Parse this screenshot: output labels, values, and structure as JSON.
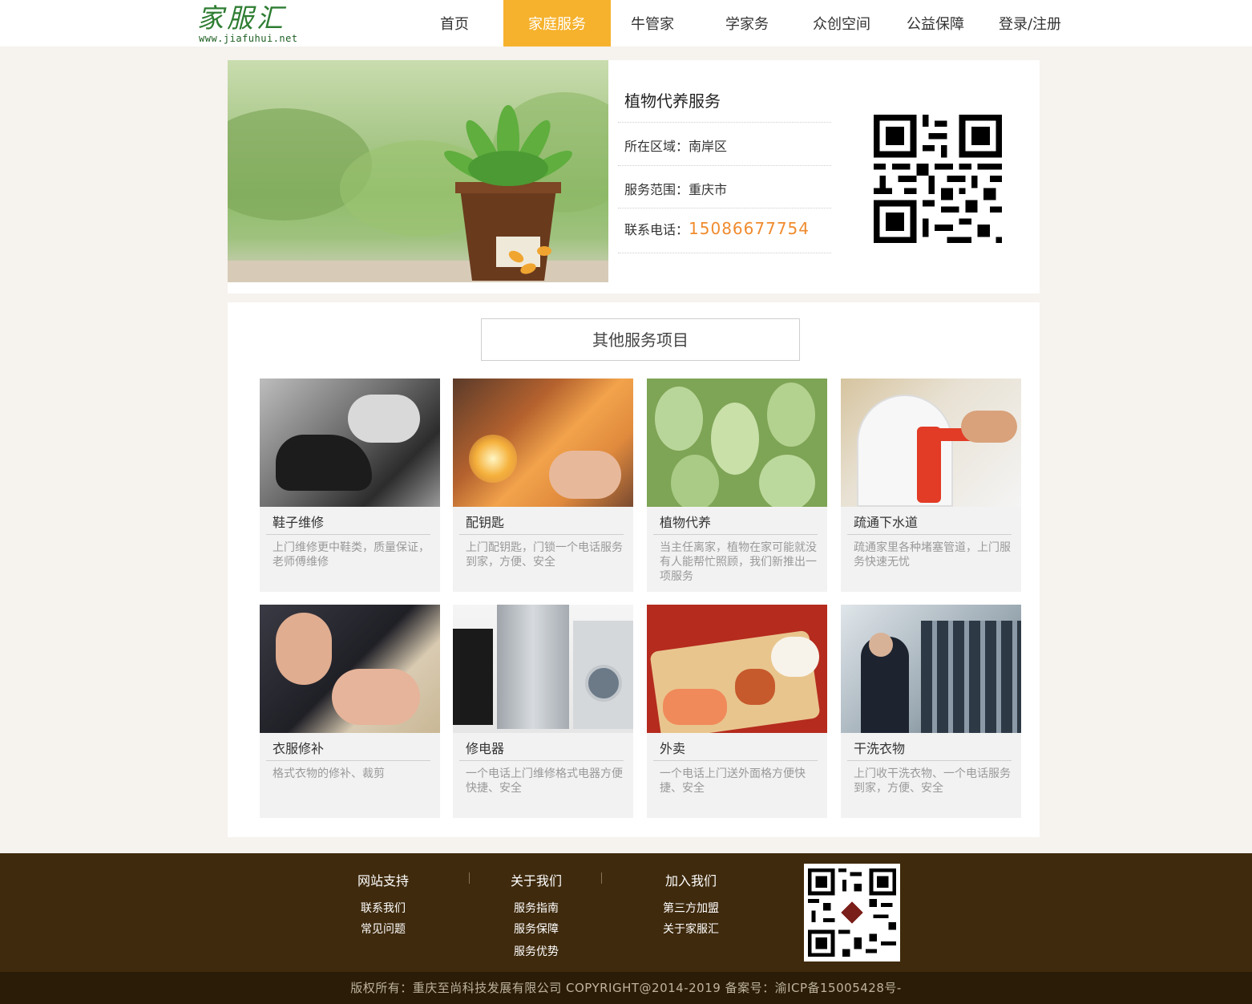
{
  "logo": {
    "main": "家服汇",
    "sub": "www.jiafuhui.net"
  },
  "nav": [
    {
      "label": "首页",
      "active": false
    },
    {
      "label": "家庭服务",
      "active": true
    },
    {
      "label": "牛管家",
      "active": false
    },
    {
      "label": "学家务",
      "active": false
    },
    {
      "label": "众创空间",
      "active": false
    },
    {
      "label": "公益保障",
      "active": false
    },
    {
      "label": "登录/注册",
      "active": false
    }
  ],
  "detail": {
    "title": "植物代养服务",
    "area_label": "所在区域：",
    "area_value": "南岸区",
    "scope_label": "服务范围：",
    "scope_value": "重庆市",
    "phone_label": "联系电话：",
    "phone_value": "15086677754"
  },
  "services": {
    "title": "其他服务项目",
    "items": [
      {
        "name": "鞋子维修",
        "desc": "上门维修更中鞋类，质量保证，老师傅维修"
      },
      {
        "name": "配钥匙",
        "desc": "上门配钥匙，门锁一个电话服务到家，方便、安全"
      },
      {
        "name": "植物代养",
        "desc": "当主任离家，植物在家可能就没有人能帮忙照顾，我们新推出一项服务"
      },
      {
        "name": "疏通下水道",
        "desc": "疏通家里各种堵塞管道，上门服务快速无忧"
      },
      {
        "name": "衣服修补",
        "desc": "格式衣物的修补、裁剪"
      },
      {
        "name": "修电器",
        "desc": "一个电话上门维修格式电器方便快捷、安全"
      },
      {
        "name": "外卖",
        "desc": "一个电话上门送外面格方便快捷、安全"
      },
      {
        "name": "干洗衣物",
        "desc": "上门收干洗衣物、一个电话服务到家，方便、安全"
      }
    ]
  },
  "footer": {
    "col1": {
      "title": "网站支持",
      "links": [
        "联系我们",
        "常见问题"
      ]
    },
    "col2": {
      "title": "关于我们",
      "links": [
        "服务指南",
        "服务保障",
        "服务优势"
      ]
    },
    "col3": {
      "title": "加入我们",
      "links": [
        "第三方加盟",
        "关于家服汇"
      ]
    },
    "copyright": "版权所有：重庆至尚科技发展有限公司 COPYRIGHT@2014-2019 备案号：渝ICP备15005428号-"
  },
  "colors": {
    "accent": "#f6b22d",
    "phone": "#f08b2e",
    "footer": "#3f2a0d",
    "brand": "#2e7d32"
  }
}
